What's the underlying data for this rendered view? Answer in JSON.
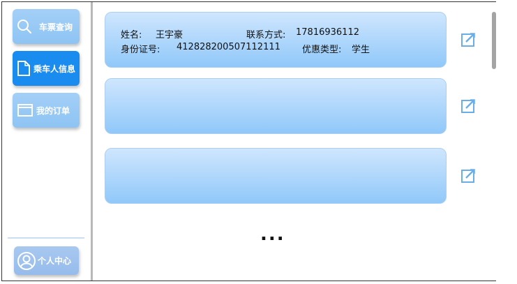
{
  "sidebar": {
    "nav": [
      {
        "label": "车票查询",
        "icon": "search-icon"
      },
      {
        "label": "乘车人信息",
        "icon": "document-icon"
      },
      {
        "label": "我的订单",
        "icon": "window-icon"
      }
    ],
    "active_index": 1,
    "profile_label": "个人中心",
    "profile_icon": "user-icon"
  },
  "passengers": [
    {
      "name_label": "姓名:",
      "name": "王宇豪",
      "contact_label": "联系方式:",
      "contact": "17816936112",
      "id_label": "身份证号:",
      "id_number": "412828200507112111",
      "discount_label": "优惠类型:",
      "discount": "学生"
    },
    {},
    {}
  ],
  "more_indicator": "...",
  "colors": {
    "nav_button": "#93c8f5",
    "nav_active": "#1a8cf0",
    "card_top": "#cfe6fe",
    "card_bottom": "#90c8f9",
    "edit_icon": "#6aaee9"
  }
}
